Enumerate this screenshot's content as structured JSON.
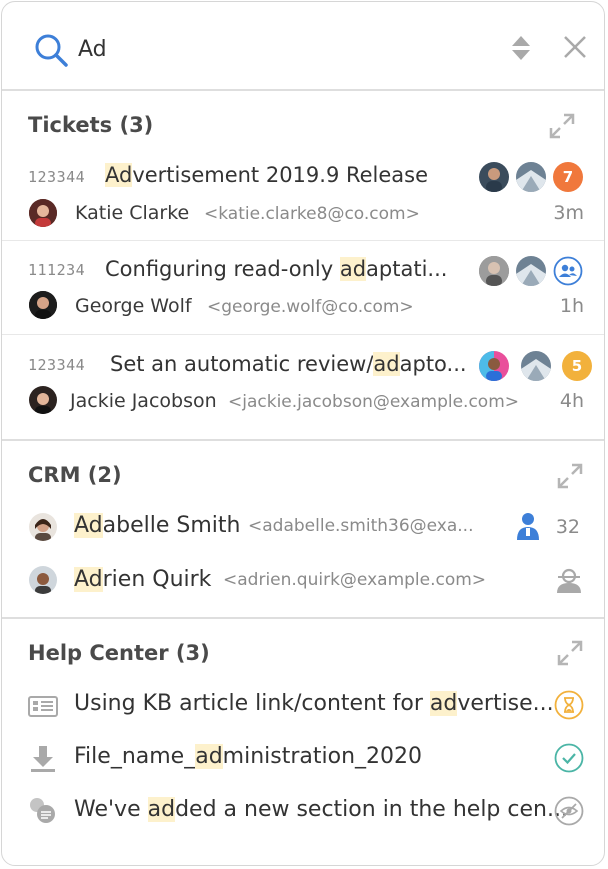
{
  "search": {
    "value": "Ad",
    "placeholder": ""
  },
  "tickets": {
    "title": "Tickets (3)",
    "items": [
      {
        "id": "123344",
        "title_hl": "Ad",
        "title_rest": "vertisement 2019.9 Release",
        "title_pre": "",
        "name": "Katie Clarke",
        "email": "<katie.clarke8@co.com>",
        "time": "3m",
        "badge": "7",
        "badge_color": "#f0783c"
      },
      {
        "id": "111234",
        "title_pre": "Configuring read-only ",
        "title_hl": "ad",
        "title_rest": "aptati...",
        "name": "George Wolf",
        "email": "<george.wolf@co.com>",
        "time": "1h",
        "badge": "",
        "badge_color": "#3d7fd8"
      },
      {
        "id": "123344",
        "title_pre": "Set an automatic review/",
        "title_hl": "ad",
        "title_rest": "apto...",
        "name": "Jackie Jacobson",
        "email": "<jackie.jacobson@example.com>",
        "time": "4h",
        "badge": "5",
        "badge_color": "#f2b13c"
      }
    ]
  },
  "crm": {
    "title": "CRM (2)",
    "items": [
      {
        "hl": "Ad",
        "rest": "abelle Smith",
        "email": "<adabelle.smith36@exa...",
        "count": "32",
        "icon": "user-blue-icon"
      },
      {
        "hl": "Ad",
        "rest": "rien Quirk",
        "email": "<adrien.quirk@example.com>",
        "count": "",
        "icon": "user-gray-icon"
      }
    ]
  },
  "help": {
    "title": "Help Center (3)",
    "items": [
      {
        "pre": "Using KB article link/content for ",
        "hl": "ad",
        "rest": "vertise...",
        "icon": "article-icon",
        "status": "hourglass-icon"
      },
      {
        "pre": "File_name_",
        "hl": "ad",
        "rest": "ministration_2020",
        "icon": "download-icon",
        "status": "check-icon"
      },
      {
        "pre": "We've ",
        "hl": "ad",
        "rest": "ded a new section in the help cen...",
        "icon": "faq-icon",
        "status": "hidden-icon"
      }
    ]
  },
  "colors": {
    "accent": "#3d7fd8",
    "highlight": "#fdf1cc",
    "orange": "#f0783c",
    "yellow": "#f2b13c",
    "teal": "#4bb5a6"
  }
}
